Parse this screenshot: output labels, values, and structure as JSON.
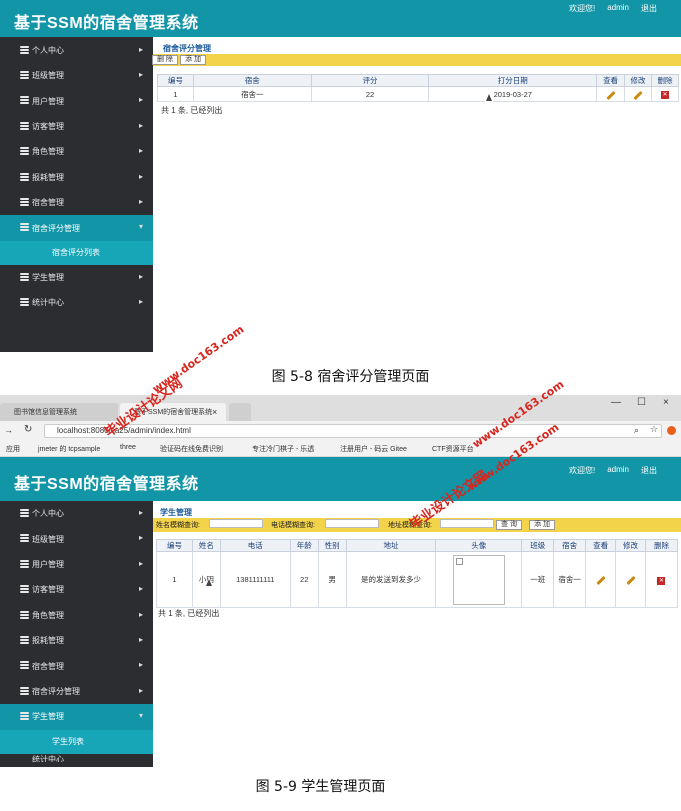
{
  "app": {
    "title": "基于SSM的宿舍管理系统",
    "welcome": "欢迎您!",
    "user": "admin",
    "logout": "退出"
  },
  "sidebar": {
    "items": [
      {
        "label": "个人中心"
      },
      {
        "label": "班级管理"
      },
      {
        "label": "用户管理"
      },
      {
        "label": "访客管理"
      },
      {
        "label": "角色管理"
      },
      {
        "label": "报耗管理"
      },
      {
        "label": "宿舍管理"
      },
      {
        "label": "宿舍评分管理"
      },
      {
        "label": "学生管理"
      },
      {
        "label": "统计中心"
      }
    ],
    "sub_rating": "宿舍评分列表",
    "sub_student": "学生列表",
    "arrow_right": "▸",
    "arrow_down": "▾"
  },
  "shot1": {
    "breadcrumb": "宿舍评分管理",
    "btn_delete": "删 除",
    "btn_add": "添 加",
    "columns": [
      "编号",
      "宿舍",
      "评分",
      "打分日期",
      "查看",
      "修改",
      "删除"
    ],
    "row": {
      "id": "1",
      "dorm": "宿舍一",
      "score": "22",
      "date": "2019-03-27"
    },
    "footer": "共 1 条, 已经列出"
  },
  "caption1": "图 5-8 宿舍评分管理页面",
  "browser": {
    "tab1": "图书馆信息管理系统",
    "tab2": "基于SSM的宿舍管理系统",
    "tab_close": "×",
    "win_min": "—",
    "win_max": "☐",
    "win_close": "×",
    "url": "localhost:8080/ca25/admin/index.html",
    "bookmarks": [
      "应用",
      "jmeter 的 tcpsample",
      "three",
      "验证码在线免费识别",
      "专注冷门棋子 - 乐透",
      "注册用户 - 码云 Gitee",
      "CTF资源平台"
    ]
  },
  "shot2": {
    "breadcrumb": "学生管理",
    "filter_name_label": "姓名模糊查询:",
    "filter_phone_label": "电话模糊查询:",
    "filter_addr_label": "地址模糊查询:",
    "btn_search": "查 询",
    "btn_add": "添 加",
    "columns": [
      "编号",
      "姓名",
      "电话",
      "年龄",
      "性别",
      "地址",
      "头像",
      "班级",
      "宿舍",
      "查看",
      "修改",
      "删除"
    ],
    "row": {
      "id": "1",
      "name": "小明",
      "phone": "1381111111",
      "age": "22",
      "gender": "男",
      "address": "是的发送到发多少",
      "class": "一班",
      "dorm": "宿舍一"
    },
    "footer": "共 1 条, 已经列出"
  },
  "caption2": "图 5-9 学生管理页面",
  "watermarks": {
    "brand": "毕业设计论文网",
    "site": "www.doc163.com"
  },
  "colors": {
    "header_teal": "#1295a6",
    "sidebar_dark": "#2b2d31",
    "toolbar_yellow": "#f3d34a",
    "watermark_red": "#d8261e"
  }
}
